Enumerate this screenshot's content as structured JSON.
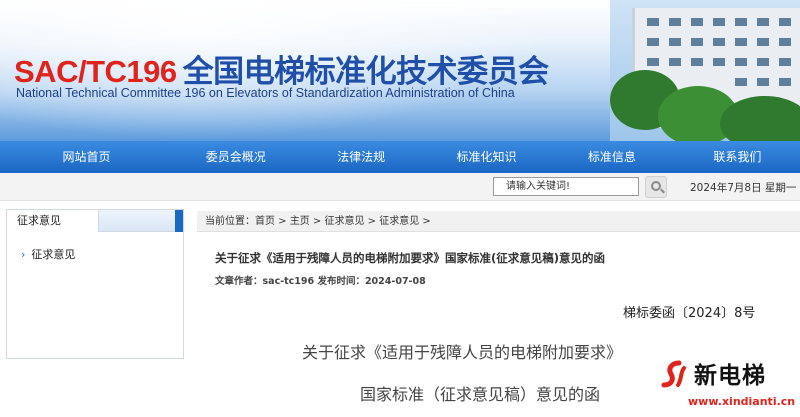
{
  "header": {
    "code": "SAC/TC196",
    "title_cn": "全国电梯标准化技术委员会",
    "title_en": "National Technical Committee 196 on Elevators of Standardization Administration of China"
  },
  "nav": {
    "items": [
      {
        "label": "网站首页"
      },
      {
        "label": "委员会概况"
      },
      {
        "label": "法律法规"
      },
      {
        "label": "标准化知识"
      },
      {
        "label": "标准信息"
      },
      {
        "label": "联系我们"
      }
    ]
  },
  "search": {
    "placeholder": "请输入关键词!",
    "date": "2024年7月8日 星期一"
  },
  "sidebar": {
    "title": "征求意见",
    "items": [
      {
        "label": "征求意见"
      }
    ]
  },
  "breadcrumb": {
    "text": "当前位置：首页 > 主页 > 征求意见 > 征求意见 >"
  },
  "article": {
    "title": "关于征求《适用于残障人员的电梯附加要求》国家标准(征求意见稿)意见的函",
    "meta": "文章作者：sac-tc196 发布时间：2024-07-08",
    "doc_number": "梯标委函〔2024〕8号",
    "body_line1": "关于征求《适用于残障人员的电梯附加要求》",
    "body_line2": "国家标准（征求意见稿）意见的函"
  },
  "watermark": {
    "name": "新电梯",
    "url": "www.xindianti.cn"
  },
  "colors": {
    "nav_blue": "#1b67c4",
    "brand_red": "#e0231c",
    "brand_blue": "#1f4fa8"
  }
}
